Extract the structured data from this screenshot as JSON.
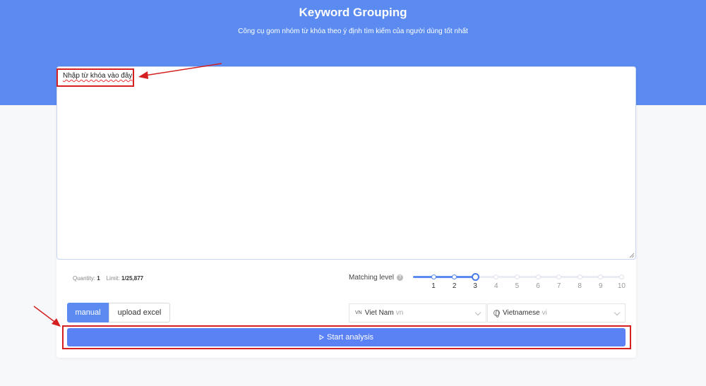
{
  "header": {
    "title": "Keyword Grouping",
    "subtitle": "Công cụ gom nhóm từ khóa theo ý định tìm kiếm của người dùng tốt nhất"
  },
  "keywords_input": {
    "placeholder": "Nhập từ khóa vào đây",
    "value": ""
  },
  "stats": {
    "quantity_label": "Quantity:",
    "quantity_value": "1",
    "limit_label": "Limit:",
    "limit_value": "1/25,877"
  },
  "matching": {
    "label": "Matching level",
    "levels": [
      "1",
      "2",
      "3",
      "4",
      "5",
      "6",
      "7",
      "8",
      "9",
      "10"
    ],
    "selected": 3
  },
  "mode_tabs": {
    "manual": "manual",
    "upload": "upload excel"
  },
  "country_select": {
    "code": "VN",
    "value": "Viet Nam",
    "suffix": "vn"
  },
  "language_select": {
    "value": "Vietnamese",
    "suffix": "vi"
  },
  "start_button": {
    "label": "Start analysis"
  },
  "colors": {
    "brand": "#5b8bf0",
    "button": "#5b82f5",
    "highlight": "#d42020"
  }
}
